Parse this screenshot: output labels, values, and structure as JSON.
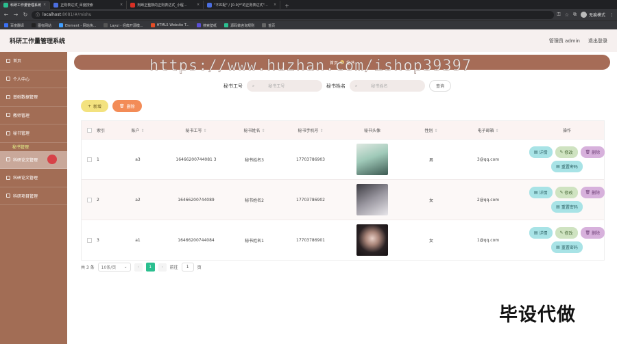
{
  "browser": {
    "tabs": [
      {
        "label": "科研工作量管理系统",
        "color": "#2bbf8f",
        "active": true
      },
      {
        "label": "正则表达式_百度搜索",
        "color": "#4b6ee0",
        "active": false
      },
      {
        "label": "判断正整数的正则表达式_小程…",
        "color": "#d93025",
        "active": false
      },
      {
        "label": "\"不匹配\" / [0-9]*\"的正则表达式\"…",
        "color": "#4b6ee0",
        "active": false
      }
    ],
    "url_host": "localhost",
    "url_rest": ":8081/#/mishu",
    "profile": "无痕模式",
    "bookmarks": [
      {
        "label": "百度翻译",
        "color": "#3b70f2"
      },
      {
        "label": "图标网站",
        "color": "#222222"
      },
      {
        "label": "Element - 网站快...",
        "color": "#409eff"
      },
      {
        "label": "Layui - 经典开源模...",
        "color": "#555555"
      },
      {
        "label": "HTML5 Website T...",
        "color": "#e44d26"
      },
      {
        "label": "搜索壁纸",
        "color": "#5a4fd6"
      },
      {
        "label": "源码做咨询规则",
        "color": "#2bbf8f"
      },
      {
        "label": "首页",
        "color": "#666666"
      }
    ]
  },
  "header": {
    "title": "科研工作量管理系统",
    "user": "管理员 admin",
    "logout": "退出登录"
  },
  "sidebar": {
    "items": [
      {
        "label": "首页"
      },
      {
        "label": "个人中心"
      },
      {
        "label": "基础数据管理"
      },
      {
        "label": "教师管理"
      },
      {
        "label": "秘书管理"
      }
    ],
    "sub_item": "秘书管理",
    "items_after": [
      {
        "label": "科研论文管理",
        "active": true
      },
      {
        "label": "科研论文管理"
      },
      {
        "label": "科研项目管理"
      }
    ]
  },
  "breadcrumb": {
    "home": "首页",
    "current": "秘书"
  },
  "search": {
    "no_label": "秘书工号",
    "no_placeholder": "秘书工号",
    "name_label": "秘书姓名",
    "name_placeholder": "秘书姓名",
    "button": "查询"
  },
  "actions": {
    "add": "新增",
    "delete": "删除"
  },
  "table": {
    "headers": [
      "索引",
      "账户",
      "秘书工号",
      "秘书姓名",
      "秘书手机号",
      "秘书头像",
      "性别",
      "电子邮箱",
      "操作"
    ],
    "rows": [
      {
        "index": "1",
        "account": "a3",
        "no": "16466200744081 3",
        "name": "秘书姓名3",
        "phone": "17703786903",
        "sex": "男",
        "email": "3@qq.com",
        "photo_color": "#9fc9b8"
      },
      {
        "index": "2",
        "account": "a2",
        "no": "16466200744089",
        "name": "秘书姓名2",
        "phone": "17703786902",
        "sex": "女",
        "email": "2@qq.com",
        "photo_color": "#6f6a6e"
      },
      {
        "index": "3",
        "account": "a1",
        "no": "16466200744084",
        "name": "秘书姓名1",
        "phone": "17703786901",
        "sex": "女",
        "email": "1@qq.com",
        "photo_color": "#3a2f30"
      }
    ],
    "ops": {
      "detail": "详情",
      "edit": "修改",
      "delete": "删除",
      "reset": "重置密码"
    }
  },
  "pager": {
    "total": "共 3 条",
    "page_size": "10条/页",
    "current": "1",
    "goto_label": "前往",
    "goto_value": "1",
    "page_unit": "页"
  },
  "watermark": "https://www.huzhan.com/ishop39397",
  "corner_text": "毕设代做"
}
